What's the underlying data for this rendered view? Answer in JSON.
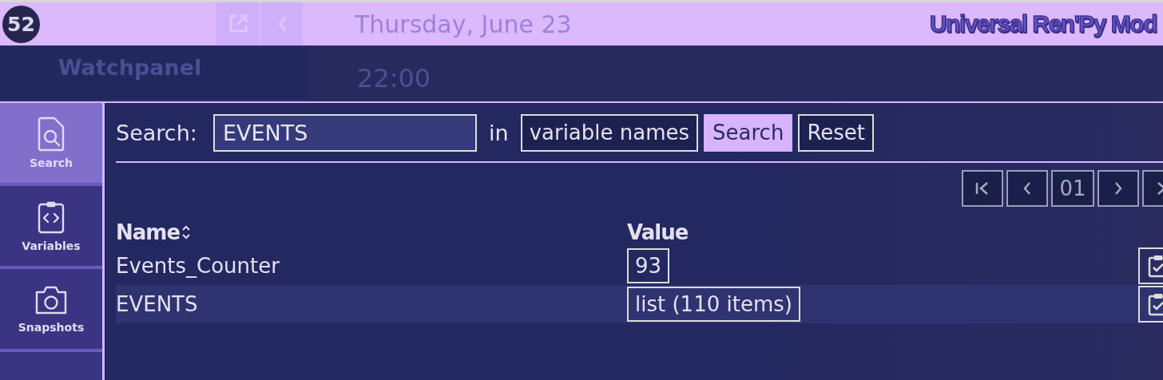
{
  "header": {
    "logo": "52",
    "date": "Thursday, June 23",
    "title": "Universal Ren'Py Mod"
  },
  "game": {
    "panel_title": "Watchpanel",
    "time": "22:00"
  },
  "sidebar": {
    "items": [
      {
        "label": "Search",
        "kind": "search",
        "selected": true
      },
      {
        "label": "Variables",
        "kind": "variables",
        "selected": false
      },
      {
        "label": "Snapshots",
        "kind": "snapshots",
        "selected": false
      }
    ]
  },
  "search": {
    "label": "Search:",
    "value": "EVENTS",
    "in_label": "in",
    "scope": "variable names",
    "buttons": [
      {
        "label": "Search",
        "primary": true
      },
      {
        "label": "Reset",
        "primary": false
      }
    ]
  },
  "pagination": {
    "page": "01"
  },
  "table": {
    "columns": [
      {
        "label": "Name",
        "sortable": true
      },
      {
        "label": "Value",
        "sortable": false
      }
    ],
    "rows": [
      {
        "name": "Events_Counter",
        "value": "93",
        "highlighted": false
      },
      {
        "name": "EVENTS",
        "value": "list (110 items)",
        "highlighted": true
      }
    ]
  }
}
